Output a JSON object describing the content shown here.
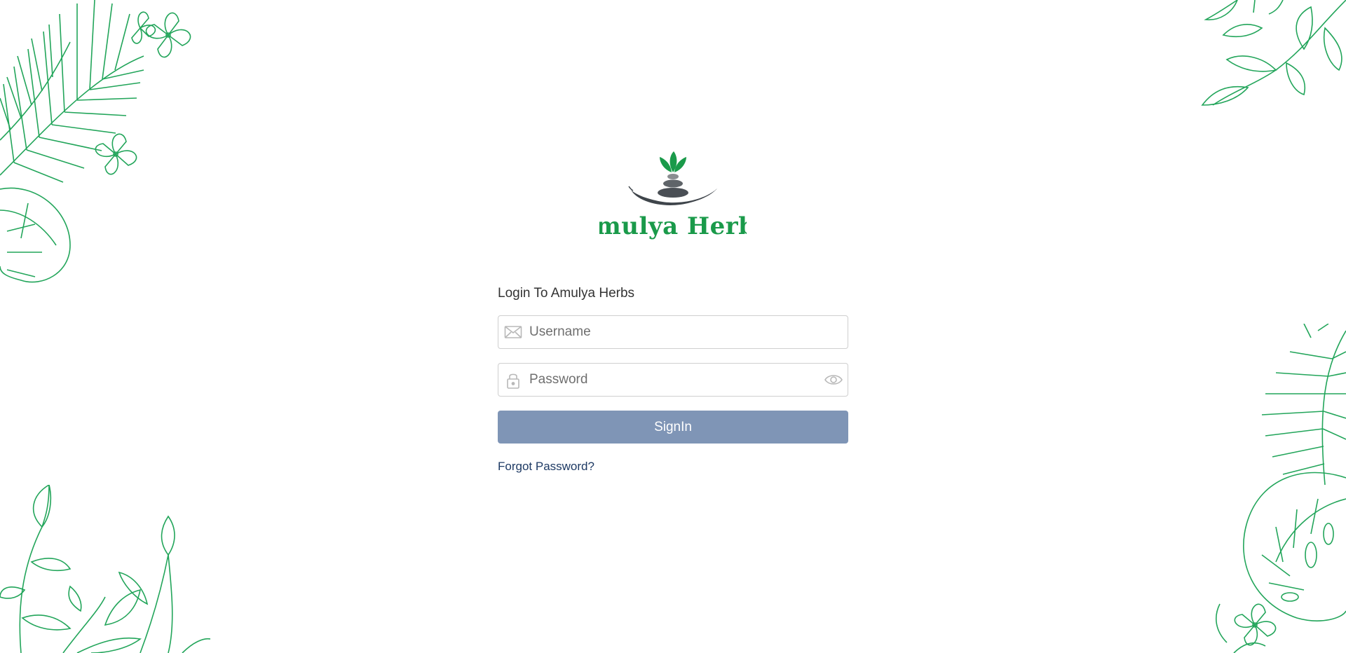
{
  "brand": {
    "name": "Amulya Herbs",
    "accent_color": "#1a9a4a",
    "stone_color": "#4a4f55"
  },
  "login": {
    "title": "Login To Amulya Herbs",
    "username_placeholder": "Username",
    "password_placeholder": "Password",
    "signin_label": "SignIn",
    "forgot_label": "Forgot Password?",
    "signin_color": "#7f95b6",
    "link_color": "#1e3a64"
  },
  "icons": {
    "username": "envelope-icon",
    "password": "lock-icon",
    "toggle_password": "eye-icon"
  },
  "decor_color": "#22a55a"
}
